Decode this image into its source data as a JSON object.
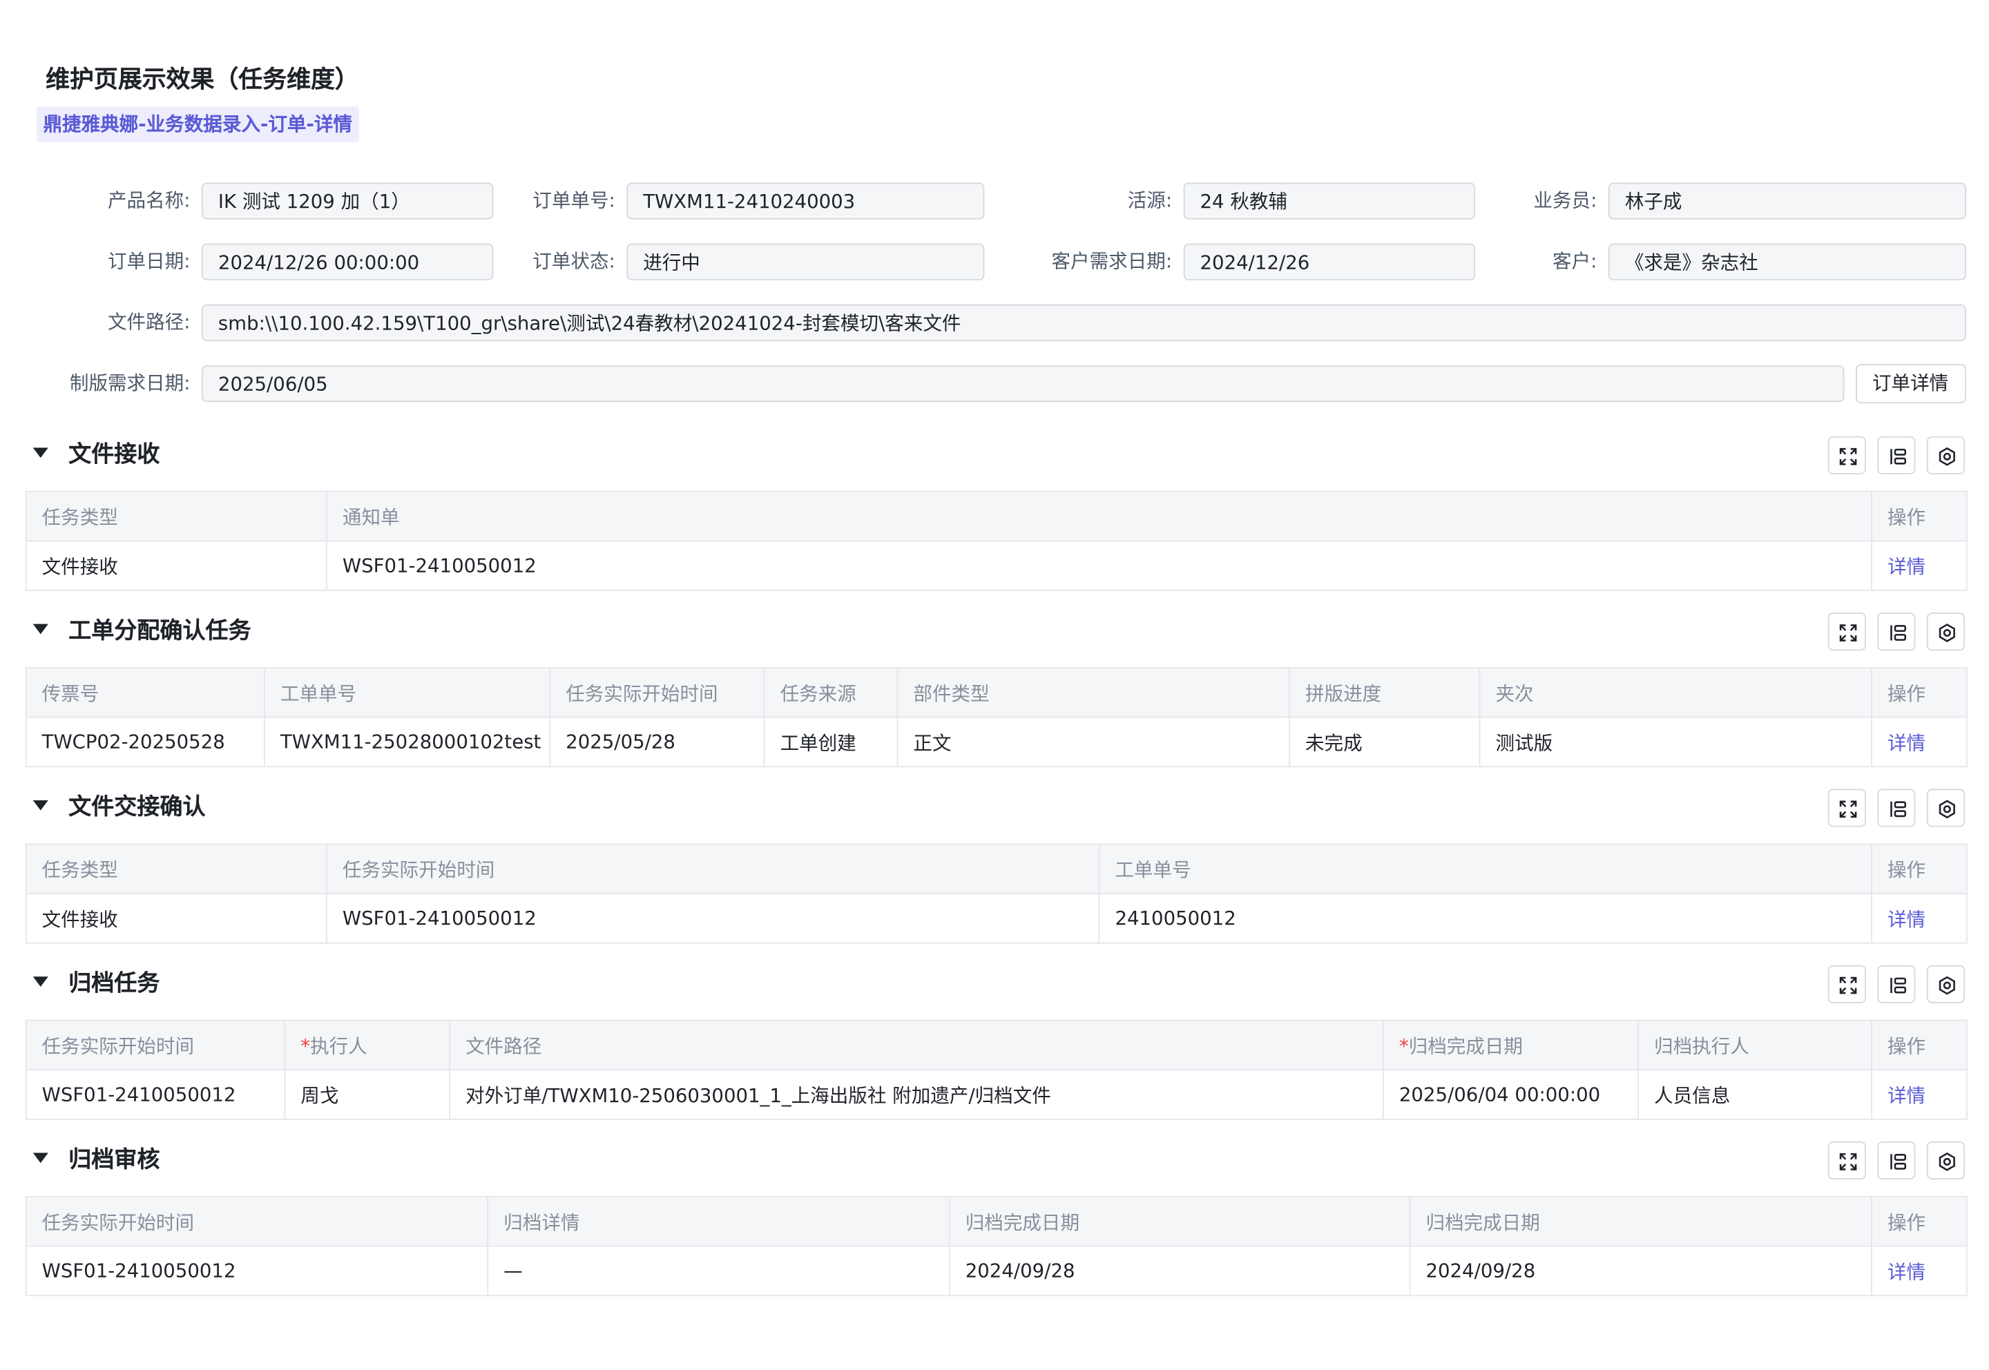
{
  "page": {
    "title": "维护页展示效果（任务维度）",
    "subtitle": "鼎捷雅典娜-业务数据录入-订单-详情"
  },
  "form": {
    "product_name": {
      "label": "产品名称:",
      "value": "IK 测试 1209 加（1）"
    },
    "order_no": {
      "label": "订单单号:",
      "value": "TWXM11-2410240003"
    },
    "source": {
      "label": "活源:",
      "value": "24 秋教辅"
    },
    "salesman": {
      "label": "业务员:",
      "value": "林子成"
    },
    "order_date": {
      "label": "订单日期:",
      "value": "2024/12/26 00:00:00"
    },
    "order_status": {
      "label": "订单状态:",
      "value": "进行中"
    },
    "customer_due_date": {
      "label": "客户需求日期:",
      "value": "2024/12/26"
    },
    "customer": {
      "label": "客户:",
      "value": "《求是》杂志社"
    },
    "file_path": {
      "label": "文件路径:",
      "value": "smb:\\\\10.100.42.159\\T100_gr\\share\\测试\\24春教材\\20241024-封套模切\\客来文件"
    },
    "plate_due_date": {
      "label": "制版需求日期:",
      "value": "2025/06/05"
    },
    "order_detail_button": "订单详情"
  },
  "icons": {
    "expand": "expand-icon",
    "columns": "columns-icon",
    "settings": "gear-icon",
    "collapse": "caret-down-icon"
  },
  "colors": {
    "accent": "#5b5bd6",
    "required": "#f53f3f",
    "header_bg": "#f5f6f8",
    "subtitle_bg": "#eeedfd"
  },
  "sections": [
    {
      "title": "文件接收",
      "columns": [
        "任务类型",
        "通知单",
        "操作"
      ],
      "rows": [
        [
          "文件接收",
          "WSF01-2410050012",
          "详情"
        ]
      ]
    },
    {
      "title": "工单分配确认任务",
      "columns": [
        "传票号",
        "工单单号",
        "任务实际开始时间",
        "任务来源",
        "部件类型",
        "拼版进度",
        "夹次",
        "操作"
      ],
      "rows": [
        [
          "TWCP02-20250528",
          "TWXM11-25028000102test",
          "2025/05/28",
          "工单创建",
          "正文",
          "未完成",
          "测试版",
          "详情"
        ]
      ]
    },
    {
      "title": "文件交接确认",
      "columns": [
        "任务类型",
        "任务实际开始时间",
        "工单单号",
        "操作"
      ],
      "rows": [
        [
          "文件接收",
          "WSF01-2410050012",
          "2410050012",
          "详情"
        ]
      ]
    },
    {
      "title": "归档任务",
      "columns": [
        "任务实际开始时间",
        "执行人",
        "文件路径",
        "归档完成日期",
        "归档执行人",
        "操作"
      ],
      "required_marker": "*",
      "rows": [
        [
          "WSF01-2410050012",
          "周戈",
          "对外订单/TWXM10-2506030001_1_上海出版社 附加遗产/归档文件",
          "2025/06/04 00:00:00",
          "人员信息",
          "详情"
        ]
      ]
    },
    {
      "title": "归档审核",
      "columns": [
        "任务实际开始时间",
        "归档详情",
        "归档完成日期",
        "归档完成日期",
        "操作"
      ],
      "rows": [
        [
          "WSF01-2410050012",
          "—",
          "2024/09/28",
          "2024/09/28",
          "详情"
        ]
      ]
    }
  ]
}
